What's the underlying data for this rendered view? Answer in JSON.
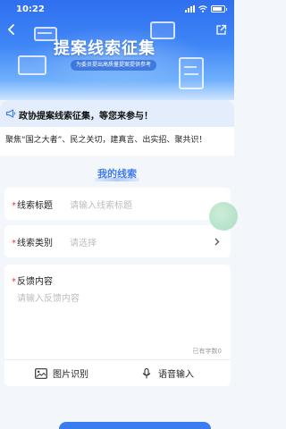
{
  "status": {
    "time": "10:22"
  },
  "banner": {
    "title": "提案线索征集",
    "subtitle": "为委员提出高质量提案提供参考"
  },
  "notice": {
    "text": "政协提案线索征集，等您来参与！"
  },
  "slogan": "聚焦“国之大者”、民之关切，建真言、出实招、聚共识！",
  "section": {
    "title": "我的线索"
  },
  "form": {
    "title_field": {
      "label": "线索标题",
      "required_mark": "*",
      "placeholder": "请输入线索标题"
    },
    "category_field": {
      "label": "线索类别",
      "required_mark": "*",
      "placeholder": "请选择"
    },
    "content_field": {
      "label": "反馈内容",
      "required_mark": "*",
      "placeholder": "请输入反馈内容",
      "counter": "已有字数0"
    },
    "tools": {
      "image_recognition": "图片识别",
      "voice_input": "语音输入"
    }
  },
  "colors": {
    "accent": "#3d7df0",
    "banner": "#2f6ff0",
    "required": "#e23b3b"
  }
}
